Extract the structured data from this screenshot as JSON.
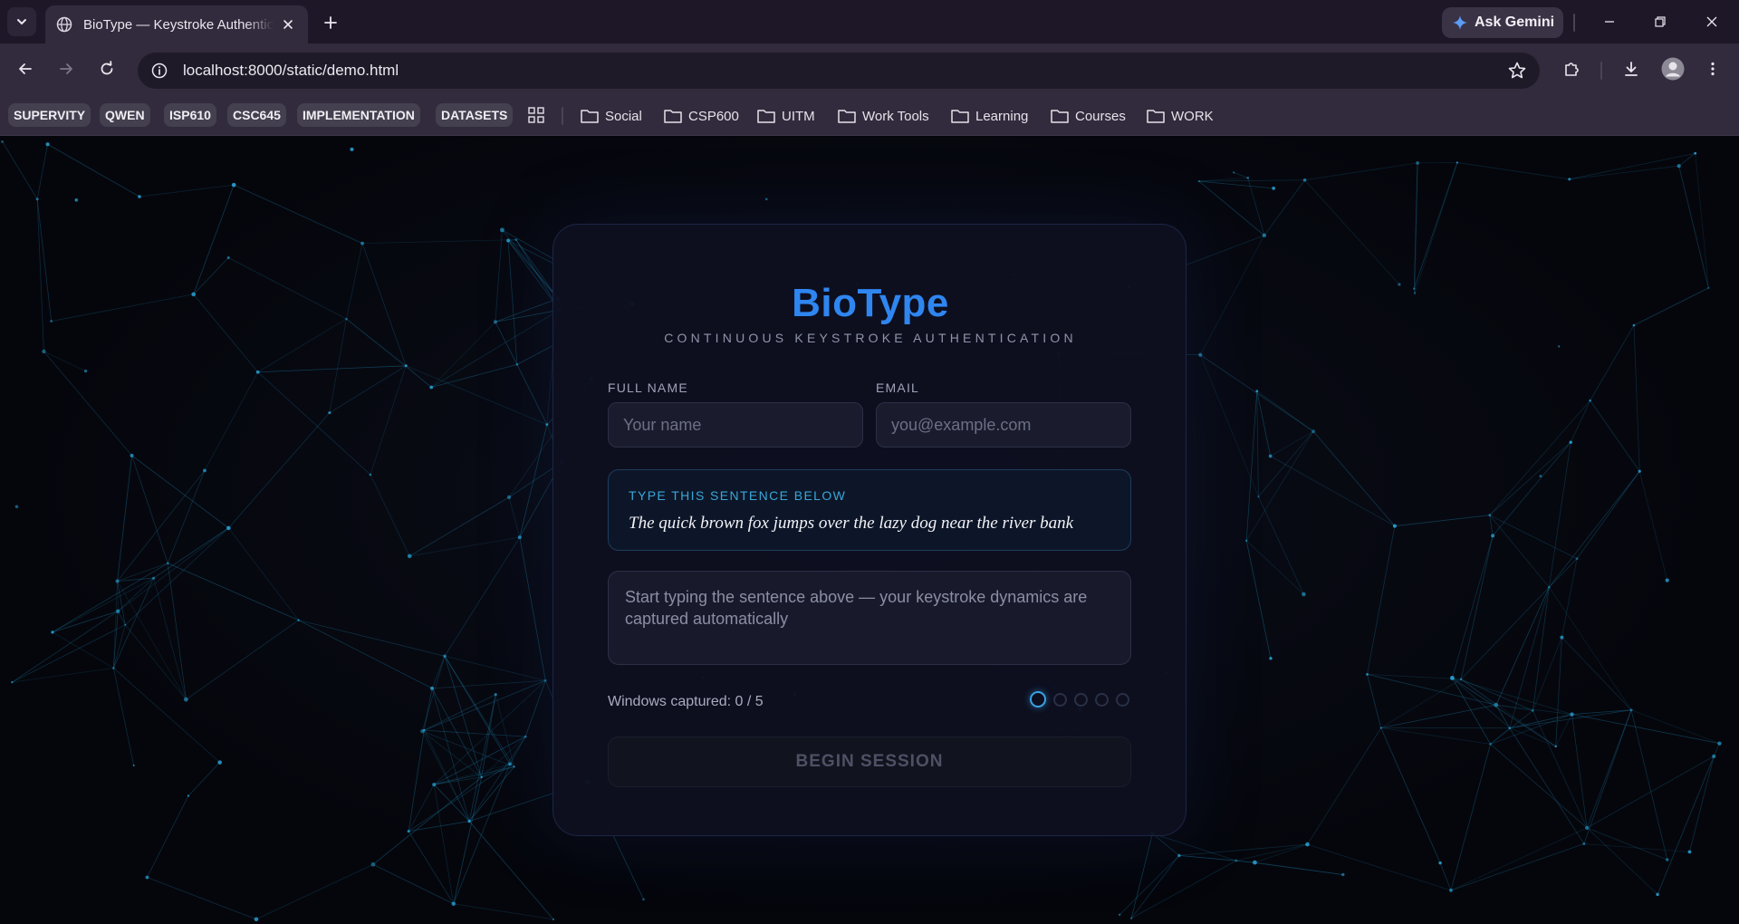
{
  "browser": {
    "tab_title": "BioType — Keystroke Authentication",
    "url": "localhost:8000/static/demo.html",
    "gemini_label": "Ask Gemini",
    "bookmarks_chips": [
      "SUPERVITY",
      "QWEN",
      "ISP610",
      "CSC645",
      "IMPLEMENTATION",
      "DATASETS"
    ],
    "bookmark_folders": [
      "Social",
      "CSP600",
      "UITM",
      "Work Tools",
      "Learning",
      "Courses",
      "WORK"
    ]
  },
  "card": {
    "brand": "BioType",
    "tagline": "CONTINUOUS KEYSTROKE AUTHENTICATION",
    "name_label": "FULL NAME",
    "name_placeholder": "Your name",
    "name_value": "",
    "email_label": "EMAIL",
    "email_placeholder": "you@example.com",
    "email_value": "",
    "prompt_label": "TYPE THIS SENTENCE BELOW",
    "prompt_sentence": "The quick brown fox jumps over the lazy dog near the river bank",
    "typing_placeholder": "Start typing the sentence above — your keystroke dynamics are captured automatically",
    "windows_captured": "Windows captured: 0 / 5",
    "windows_total": 5,
    "windows_done": 0,
    "begin_label": "BEGIN SESSION"
  },
  "colors": {
    "brand": "#2f86f0",
    "accent": "#3aa3e6",
    "background": "#05060c"
  }
}
